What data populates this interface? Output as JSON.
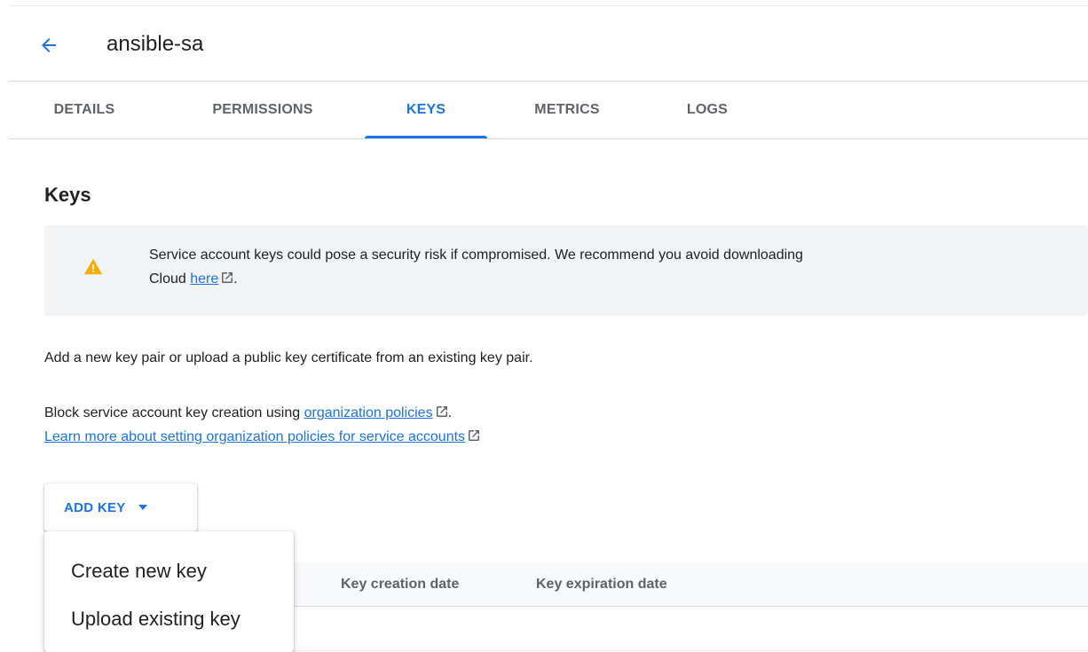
{
  "header": {
    "title": "ansible-sa",
    "back_icon": "arrow-left-icon"
  },
  "tabs": [
    {
      "label": "DETAILS"
    },
    {
      "label": "PERMISSIONS"
    },
    {
      "label": "KEYS",
      "active": true
    },
    {
      "label": "METRICS"
    },
    {
      "label": "LOGS"
    }
  ],
  "keys": {
    "title": "Keys",
    "warning": {
      "icon": "warning-icon",
      "line1": "Service account keys could pose a security risk if compromised. We recommend you avoid downloading",
      "line2_prefix": "Cloud ",
      "line2_link": "here",
      "line2_suffix": "."
    },
    "intro": "Add a new key pair or upload a public key certificate from an existing key pair.",
    "block": {
      "prefix": "Block service account key creation using ",
      "link": "organization policies",
      "suffix": ".",
      "learn_more": "Learn more about setting organization policies for service accounts"
    },
    "add_key_label": "ADD KEY",
    "menu": {
      "create": "Create new key",
      "upload": "Upload existing key"
    },
    "table": {
      "columns": [
        "Key creation date",
        "Key expiration date"
      ]
    }
  },
  "colors": {
    "accent": "#1a73e8",
    "warning": "#f9ab00",
    "panel": "#f1f3f4"
  }
}
